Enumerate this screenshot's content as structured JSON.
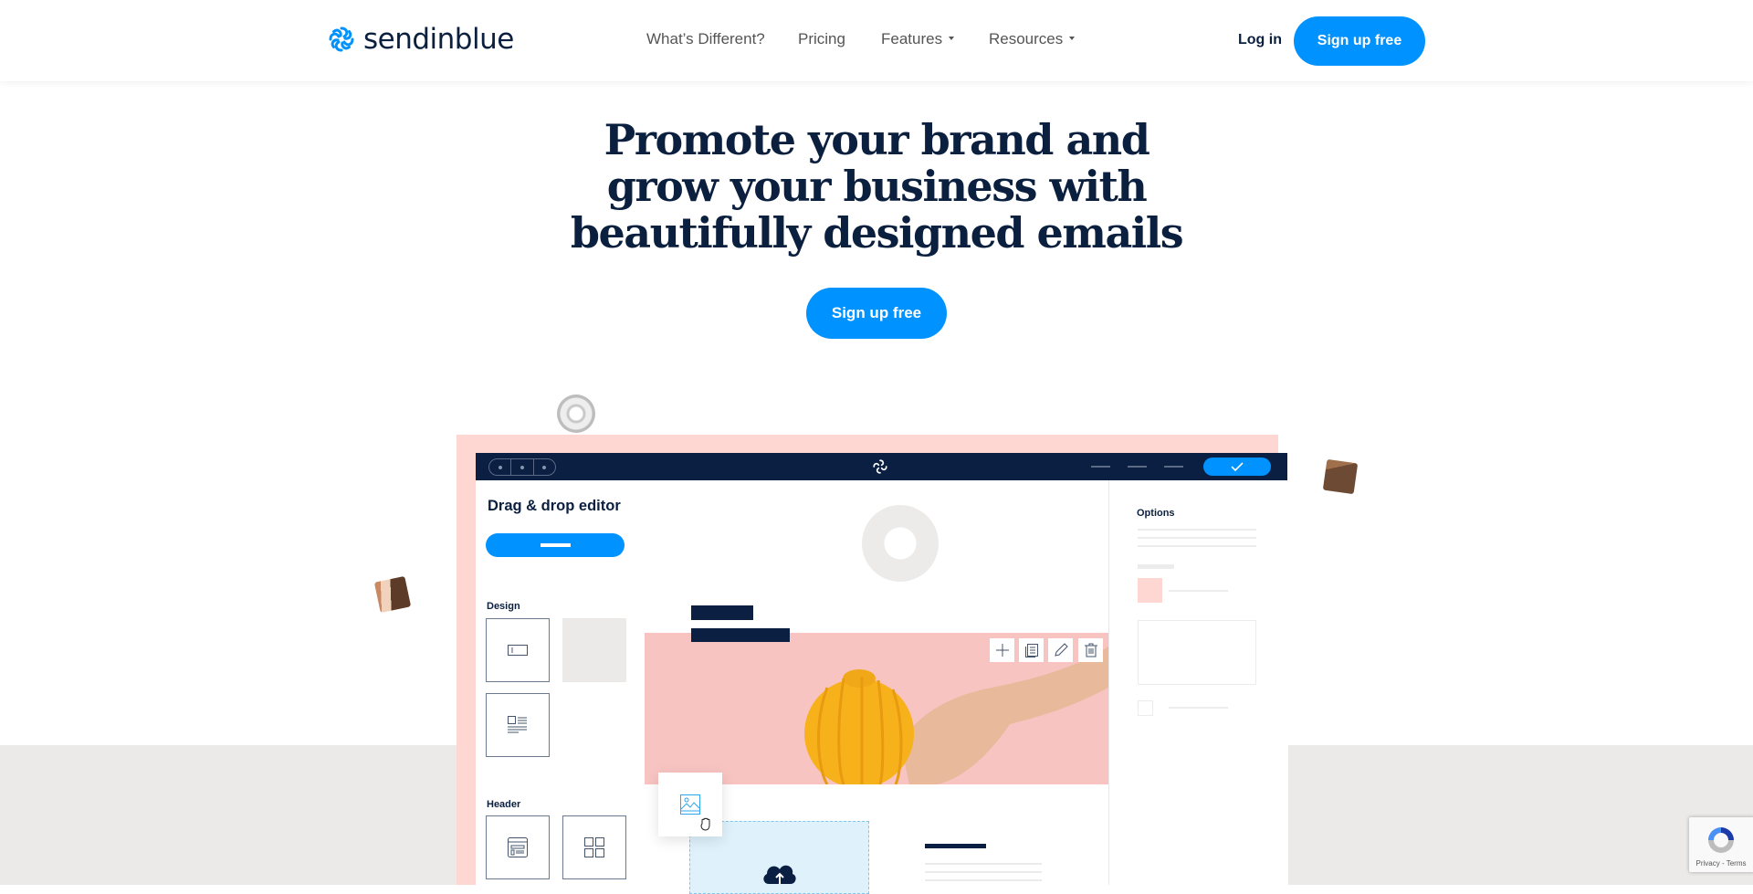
{
  "header": {
    "brand": "sendinblue",
    "brand_icon": "sendinblue-swirl-icon",
    "nav": [
      {
        "label": "What’s Different?",
        "has_dropdown": false
      },
      {
        "label": "Pricing",
        "has_dropdown": false
      },
      {
        "label": "Features",
        "has_dropdown": true
      },
      {
        "label": "Resources",
        "has_dropdown": true
      }
    ],
    "login_label": "Log in",
    "signup_label": "Sign up free"
  },
  "hero": {
    "title_lines": [
      "Promote your brand and",
      "grow your business with",
      "beautifully designed emails"
    ],
    "cta_label": "Sign up free"
  },
  "editor_mock": {
    "topbar": {
      "logo_icon": "sendinblue-swirl-icon",
      "confirm_icon": "check-icon"
    },
    "sidebar": {
      "title": "Drag & drop editor",
      "section_design": "Design",
      "section_header": "Header",
      "design_tiles": [
        "text-field-icon",
        "image-text-icon"
      ],
      "header_tiles": [
        "browser-layout-icon",
        "grid-layout-icon"
      ]
    },
    "toolbar_icons": [
      "plus-icon",
      "duplicate-icon",
      "pencil-icon",
      "trash-icon"
    ],
    "drag_tile_icon": "image-icon",
    "cursor_icon": "grab-hand-icon",
    "upload_icon": "cloud-upload-icon",
    "options": {
      "title": "Options"
    }
  },
  "recaptcha": {
    "label": "Privacy - Terms"
  },
  "colors": {
    "brand_blue": "#0092ff",
    "navy": "#0b1f3f",
    "pink": "#ffd7d2",
    "gray_band": "#ebeae8"
  }
}
